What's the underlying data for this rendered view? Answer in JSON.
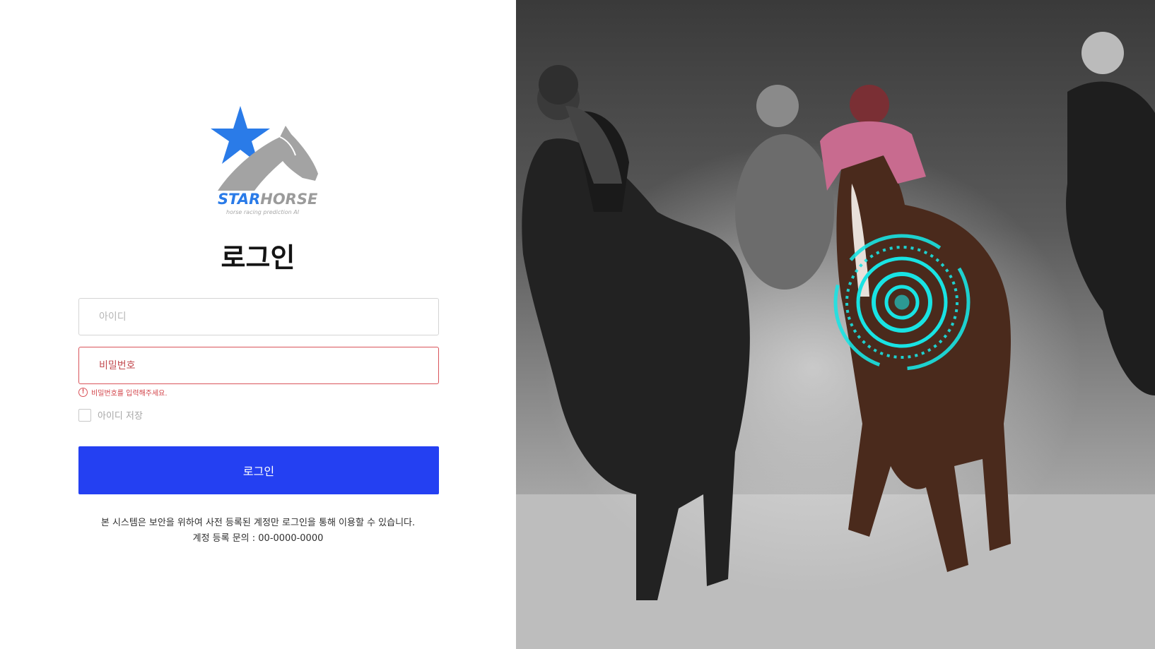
{
  "logo": {
    "word_star": "STAR",
    "word_horse": "HORSE",
    "tagline": "horse racing prediction AI",
    "colors": {
      "star": "#2a7be8",
      "horse": "#9b9b9b"
    }
  },
  "page_title": "로그인",
  "form": {
    "id_placeholder": "아이디",
    "password_placeholder": "비밀번호",
    "password_error": "비밀번호를 입력해주세요.",
    "remember_label": "아이디 저장",
    "remember_checked": false,
    "login_button": "로그인",
    "colors": {
      "button": "#2440f2",
      "error": "#d24248"
    }
  },
  "notice": {
    "line1": "본 시스템은 보안을 위하여 사전 등록된 계정만 로그인을 통해 이용할 수 있습니다.",
    "line2": "계정 등록 문의 : 00-0000-0000"
  },
  "hero_image": {
    "subject": "horse racing photo with target reticle",
    "accent_color": "#19e3e3"
  }
}
